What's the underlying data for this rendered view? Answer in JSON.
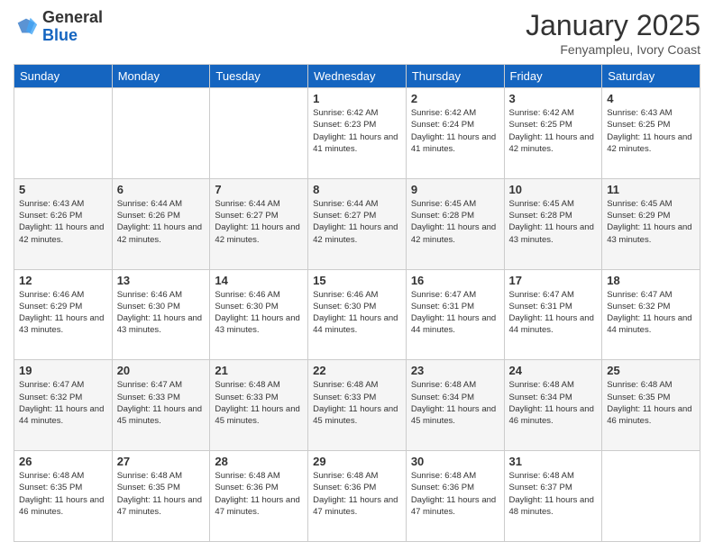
{
  "header": {
    "logo_general": "General",
    "logo_blue": "Blue",
    "title": "January 2025",
    "subtitle": "Fenyampleu, Ivory Coast"
  },
  "days_of_week": [
    "Sunday",
    "Monday",
    "Tuesday",
    "Wednesday",
    "Thursday",
    "Friday",
    "Saturday"
  ],
  "weeks": [
    [
      {
        "day": "",
        "info": ""
      },
      {
        "day": "",
        "info": ""
      },
      {
        "day": "",
        "info": ""
      },
      {
        "day": "1",
        "info": "Sunrise: 6:42 AM\nSunset: 6:23 PM\nDaylight: 11 hours and 41 minutes."
      },
      {
        "day": "2",
        "info": "Sunrise: 6:42 AM\nSunset: 6:24 PM\nDaylight: 11 hours and 41 minutes."
      },
      {
        "day": "3",
        "info": "Sunrise: 6:42 AM\nSunset: 6:25 PM\nDaylight: 11 hours and 42 minutes."
      },
      {
        "day": "4",
        "info": "Sunrise: 6:43 AM\nSunset: 6:25 PM\nDaylight: 11 hours and 42 minutes."
      }
    ],
    [
      {
        "day": "5",
        "info": "Sunrise: 6:43 AM\nSunset: 6:26 PM\nDaylight: 11 hours and 42 minutes."
      },
      {
        "day": "6",
        "info": "Sunrise: 6:44 AM\nSunset: 6:26 PM\nDaylight: 11 hours and 42 minutes."
      },
      {
        "day": "7",
        "info": "Sunrise: 6:44 AM\nSunset: 6:27 PM\nDaylight: 11 hours and 42 minutes."
      },
      {
        "day": "8",
        "info": "Sunrise: 6:44 AM\nSunset: 6:27 PM\nDaylight: 11 hours and 42 minutes."
      },
      {
        "day": "9",
        "info": "Sunrise: 6:45 AM\nSunset: 6:28 PM\nDaylight: 11 hours and 42 minutes."
      },
      {
        "day": "10",
        "info": "Sunrise: 6:45 AM\nSunset: 6:28 PM\nDaylight: 11 hours and 43 minutes."
      },
      {
        "day": "11",
        "info": "Sunrise: 6:45 AM\nSunset: 6:29 PM\nDaylight: 11 hours and 43 minutes."
      }
    ],
    [
      {
        "day": "12",
        "info": "Sunrise: 6:46 AM\nSunset: 6:29 PM\nDaylight: 11 hours and 43 minutes."
      },
      {
        "day": "13",
        "info": "Sunrise: 6:46 AM\nSunset: 6:30 PM\nDaylight: 11 hours and 43 minutes."
      },
      {
        "day": "14",
        "info": "Sunrise: 6:46 AM\nSunset: 6:30 PM\nDaylight: 11 hours and 43 minutes."
      },
      {
        "day": "15",
        "info": "Sunrise: 6:46 AM\nSunset: 6:30 PM\nDaylight: 11 hours and 44 minutes."
      },
      {
        "day": "16",
        "info": "Sunrise: 6:47 AM\nSunset: 6:31 PM\nDaylight: 11 hours and 44 minutes."
      },
      {
        "day": "17",
        "info": "Sunrise: 6:47 AM\nSunset: 6:31 PM\nDaylight: 11 hours and 44 minutes."
      },
      {
        "day": "18",
        "info": "Sunrise: 6:47 AM\nSunset: 6:32 PM\nDaylight: 11 hours and 44 minutes."
      }
    ],
    [
      {
        "day": "19",
        "info": "Sunrise: 6:47 AM\nSunset: 6:32 PM\nDaylight: 11 hours and 44 minutes."
      },
      {
        "day": "20",
        "info": "Sunrise: 6:47 AM\nSunset: 6:33 PM\nDaylight: 11 hours and 45 minutes."
      },
      {
        "day": "21",
        "info": "Sunrise: 6:48 AM\nSunset: 6:33 PM\nDaylight: 11 hours and 45 minutes."
      },
      {
        "day": "22",
        "info": "Sunrise: 6:48 AM\nSunset: 6:33 PM\nDaylight: 11 hours and 45 minutes."
      },
      {
        "day": "23",
        "info": "Sunrise: 6:48 AM\nSunset: 6:34 PM\nDaylight: 11 hours and 45 minutes."
      },
      {
        "day": "24",
        "info": "Sunrise: 6:48 AM\nSunset: 6:34 PM\nDaylight: 11 hours and 46 minutes."
      },
      {
        "day": "25",
        "info": "Sunrise: 6:48 AM\nSunset: 6:35 PM\nDaylight: 11 hours and 46 minutes."
      }
    ],
    [
      {
        "day": "26",
        "info": "Sunrise: 6:48 AM\nSunset: 6:35 PM\nDaylight: 11 hours and 46 minutes."
      },
      {
        "day": "27",
        "info": "Sunrise: 6:48 AM\nSunset: 6:35 PM\nDaylight: 11 hours and 47 minutes."
      },
      {
        "day": "28",
        "info": "Sunrise: 6:48 AM\nSunset: 6:36 PM\nDaylight: 11 hours and 47 minutes."
      },
      {
        "day": "29",
        "info": "Sunrise: 6:48 AM\nSunset: 6:36 PM\nDaylight: 11 hours and 47 minutes."
      },
      {
        "day": "30",
        "info": "Sunrise: 6:48 AM\nSunset: 6:36 PM\nDaylight: 11 hours and 47 minutes."
      },
      {
        "day": "31",
        "info": "Sunrise: 6:48 AM\nSunset: 6:37 PM\nDaylight: 11 hours and 48 minutes."
      },
      {
        "day": "",
        "info": ""
      }
    ]
  ]
}
